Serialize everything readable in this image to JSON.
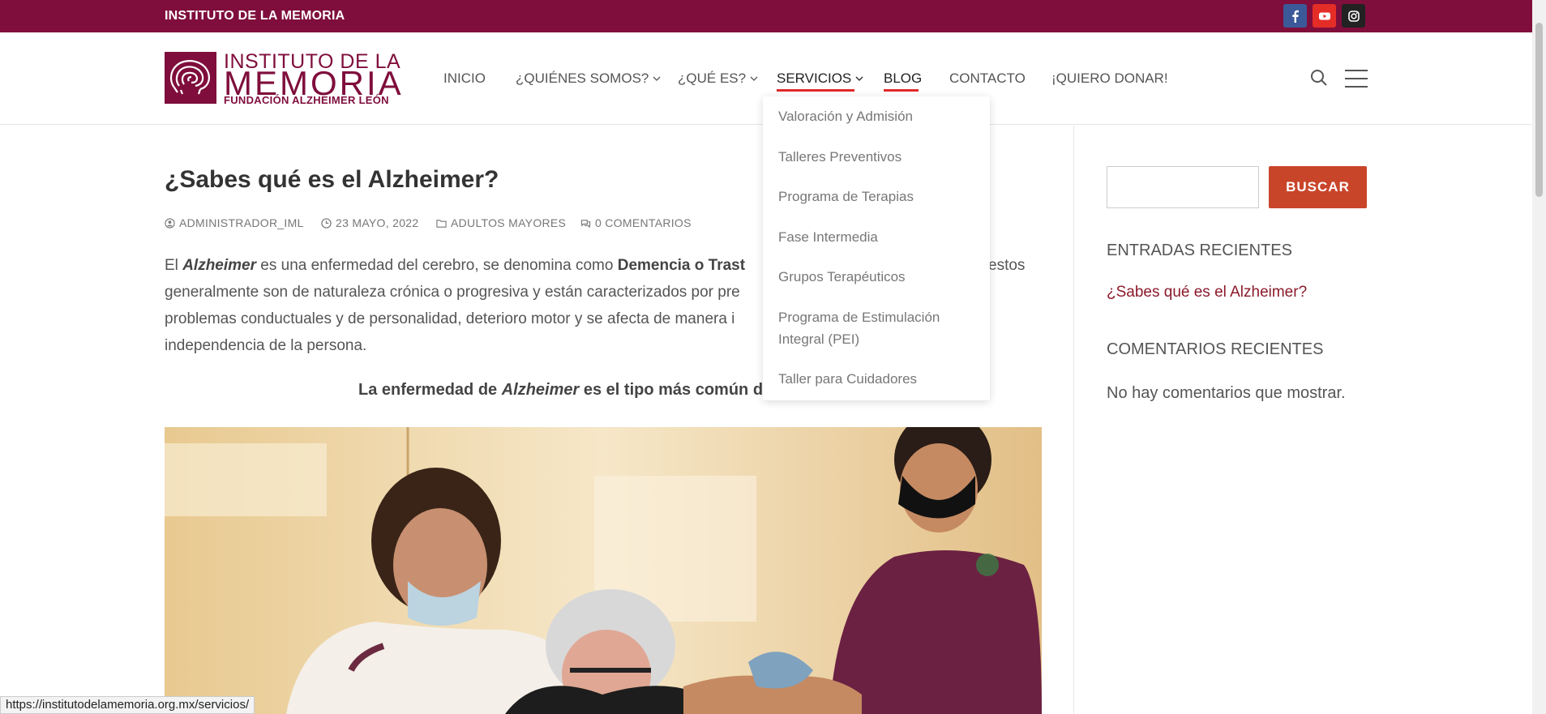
{
  "topbar": {
    "site_name": "INSTITUTO DE LA MEMORIA",
    "social": [
      "facebook-icon",
      "youtube-icon",
      "instagram-icon"
    ]
  },
  "logo": {
    "line1": "INSTITUTO DE LA",
    "line2": "MEMORIA",
    "line3": "FUNDACIÓN ALZHEIMER LEÓN"
  },
  "nav": {
    "items": [
      {
        "label": "INICIO"
      },
      {
        "label": "¿QUIÉNES SOMOS?"
      },
      {
        "label": "¿QUÉ ES?"
      },
      {
        "label": "SERVICIOS"
      },
      {
        "label": "BLOG"
      },
      {
        "label": "CONTACTO"
      },
      {
        "label": "¡QUIERO DONAR!"
      }
    ]
  },
  "dropdown": {
    "items": [
      "Valoración y Admisión",
      "Talleres Preventivos",
      "Programa de Terapias",
      "Fase Intermedia",
      "Grupos Terapéuticos",
      "Programa de Estimulación Integral (PEI)",
      "Taller para Cuidadores"
    ]
  },
  "post": {
    "title": "¿Sabes qué es el Alzheimer?",
    "author": "ADMINISTRADOR_IML",
    "date": "23 MAYO, 2022",
    "category": "ADULTOS MAYORES",
    "comments": "0 COMENTARIOS",
    "p1": {
      "a": "El ",
      "b": "Alzheimer",
      "c": " es una enfermedad del cerebro, se denomina como ",
      "d": "Demencia o Trast",
      "e": "estos",
      "line2": "generalmente son de naturaleza crónica o progresiva y están caracterizados por pre",
      "line3": "problemas conductuales y de personalidad, deterioro motor y se afecta de manera i",
      "line4": "independencia de la persona."
    },
    "highlight": {
      "a": "La enfermedad de ",
      "b": "Alzheimer",
      "c": " es el tipo más común de"
    }
  },
  "sidebar": {
    "search_button": "BUSCAR",
    "recent_posts_title": "ENTRADAS RECIENTES",
    "recent_post_link": "¿Sabes qué es el Alzheimer?",
    "recent_comments_title": "COMENTARIOS RECIENTES",
    "no_comments": "No hay comentarios que mostrar."
  },
  "statusbar": {
    "url": "https://institutodelamemoria.org.mx/servicios/"
  },
  "colors": {
    "brand": "#7f0e3c",
    "accent": "#c9452a",
    "underline": "#e12b2b",
    "link": "#8b1a2b"
  }
}
